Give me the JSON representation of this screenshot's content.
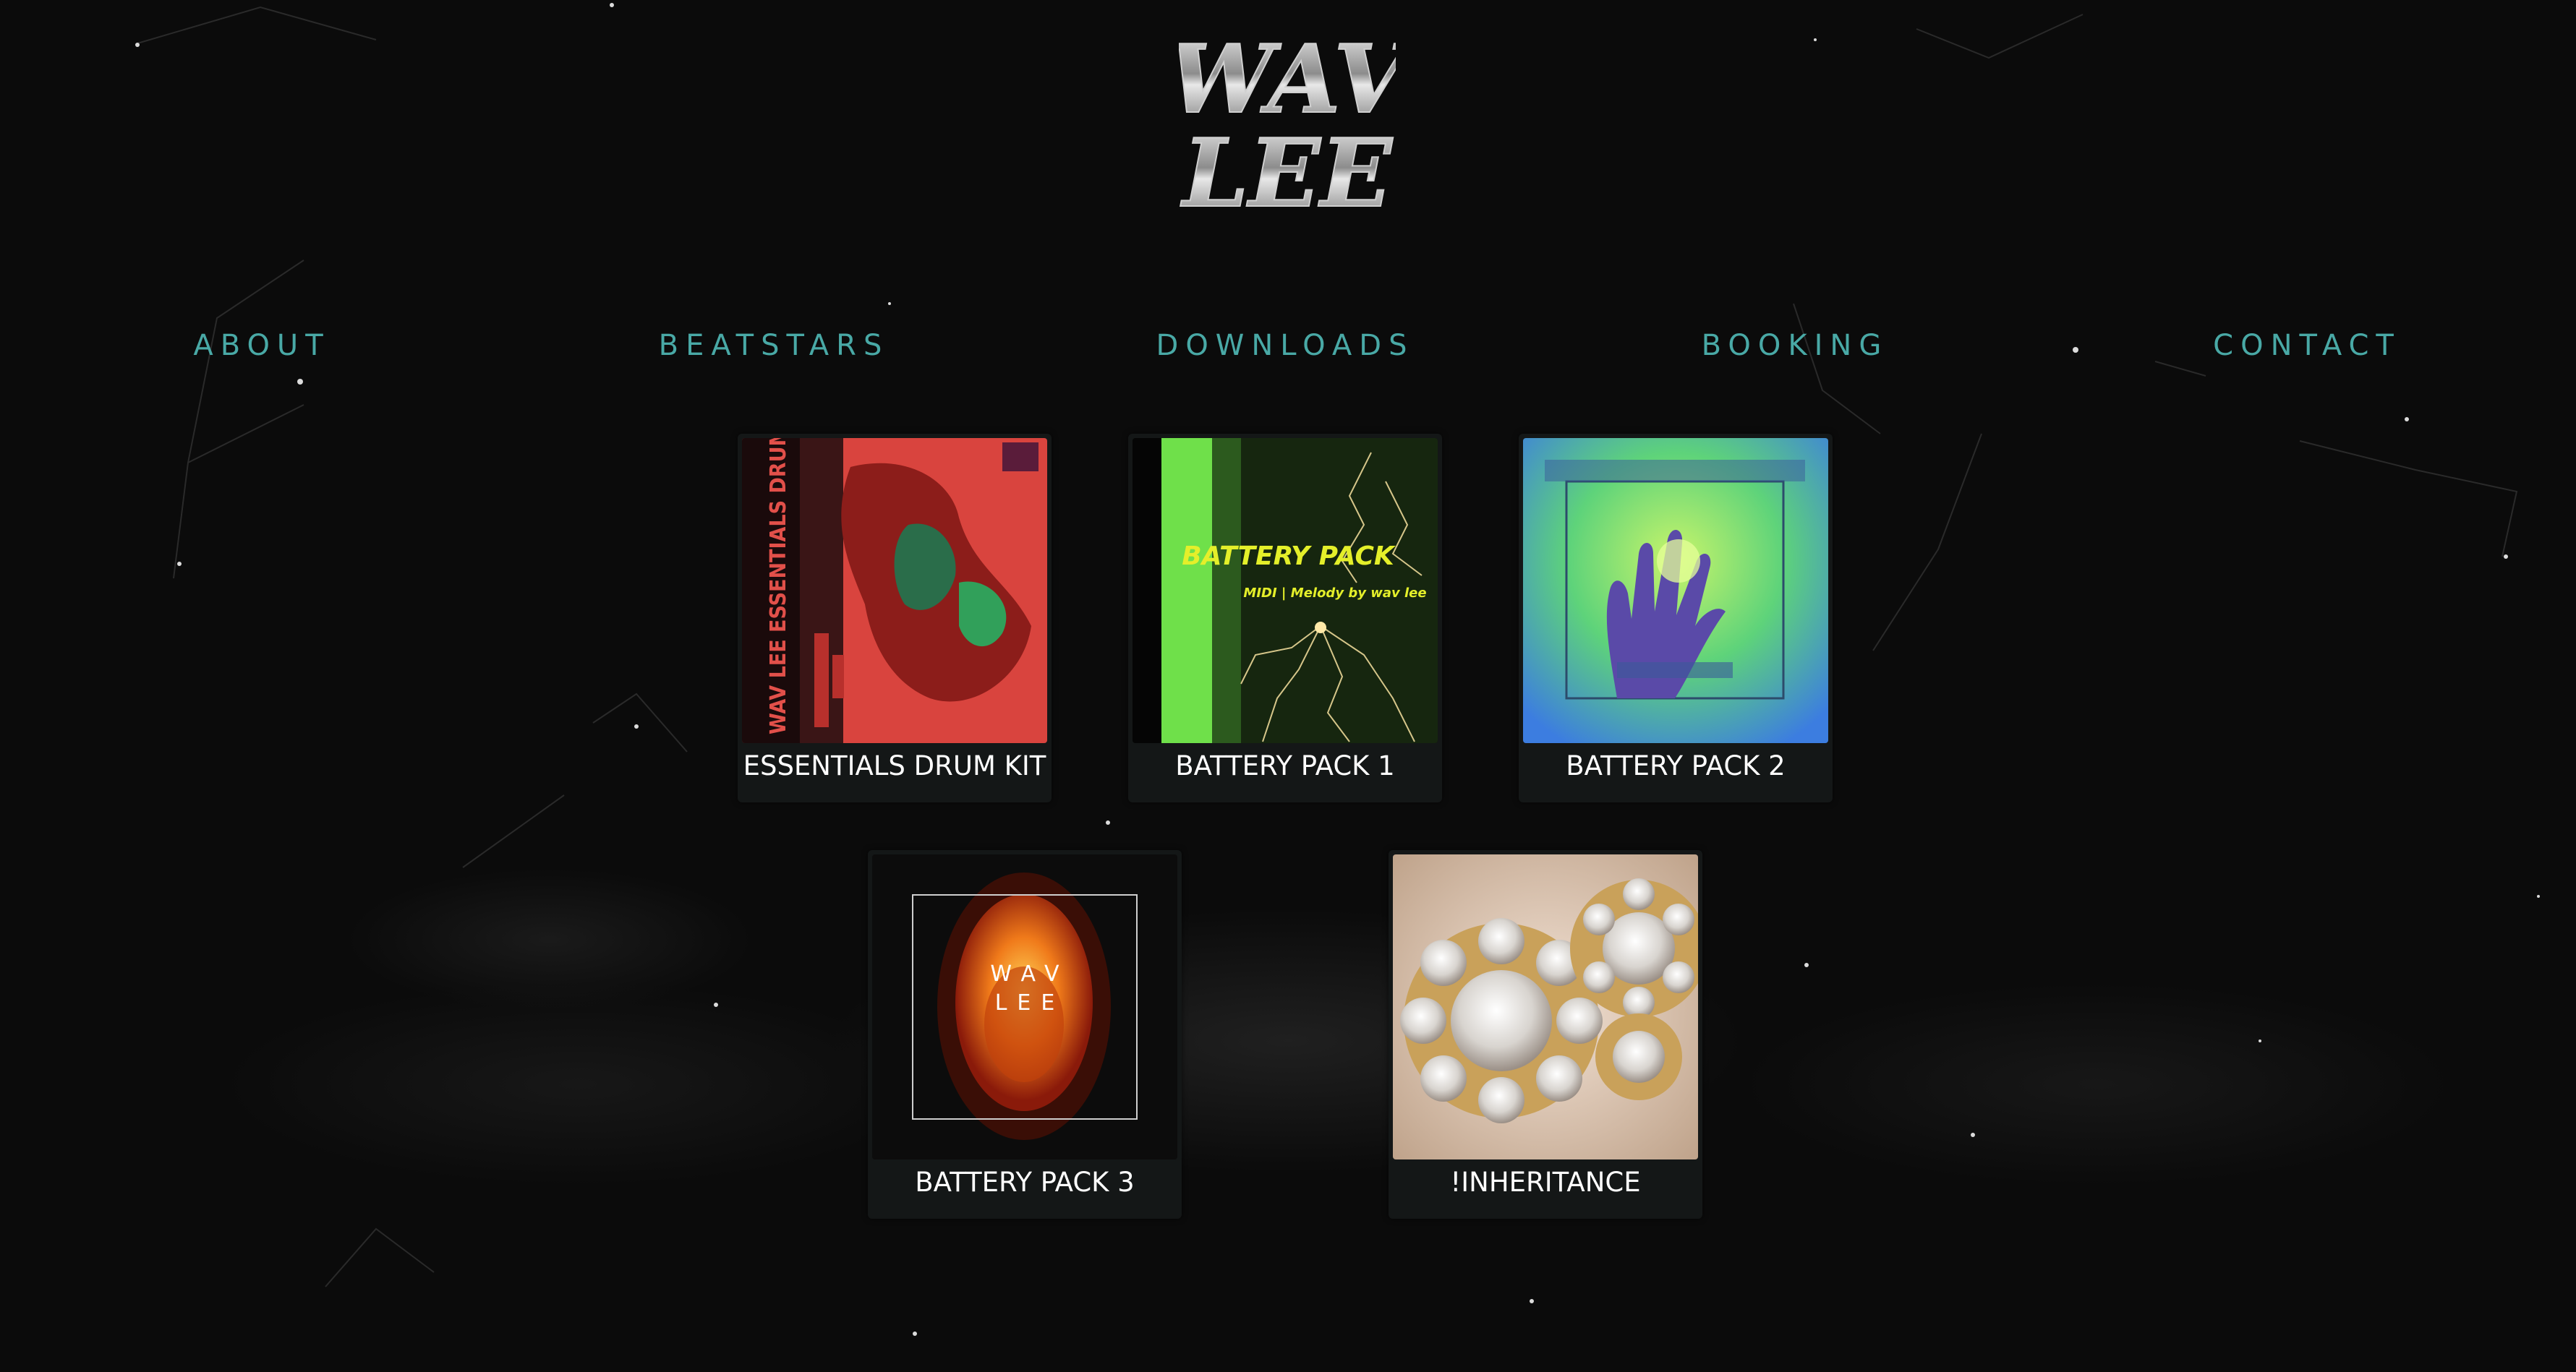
{
  "brand": {
    "logo_text_line1": "WAV",
    "logo_text_line2": "LEE"
  },
  "nav": {
    "items": [
      {
        "label": "ABOUT"
      },
      {
        "label": "BEATSTARS"
      },
      {
        "label": "DOWNLOADS"
      },
      {
        "label": "BOOKING"
      },
      {
        "label": "CONTACT"
      }
    ]
  },
  "products": [
    {
      "title": "ESSENTIALS DRUM KIT",
      "cover_text": "WAV LEE ESSENTIALS DRUM KIT"
    },
    {
      "title": "BATTERY PACK 1",
      "cover_text": "BATTERY PACK",
      "cover_subtext": "MIDI | Melody by wav lee"
    },
    {
      "title": "BATTERY PACK 2"
    },
    {
      "title": "BATTERY PACK 3",
      "cover_text_line1": "WAV",
      "cover_text_line2": "LEE"
    },
    {
      "title": "!INHERITANCE"
    }
  ],
  "colors": {
    "background": "#0b0b0b",
    "nav_text": "#49a9a6",
    "card_background": "#141717",
    "card_title": "#ffffff"
  }
}
